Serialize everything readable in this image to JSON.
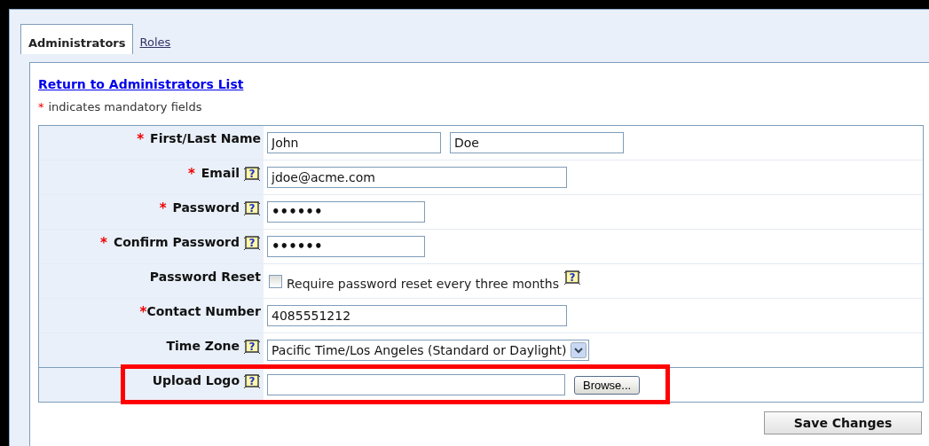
{
  "tabs": [
    {
      "label": "Administrators",
      "selected": true
    },
    {
      "label": "Roles",
      "selected": false
    }
  ],
  "return_link": "Return to Administrators List",
  "legend": {
    "mark": "*",
    "text": "indicates mandatory fields"
  },
  "form": {
    "rows": [
      {
        "kind": "name",
        "label": "First/Last Name",
        "required": true,
        "help": false,
        "values": [
          "John",
          "Doe"
        ]
      },
      {
        "kind": "text",
        "label": "Email",
        "required": true,
        "help": true,
        "value": "jdoe@acme.com"
      },
      {
        "kind": "password",
        "label": "Password",
        "required": true,
        "help": true,
        "value": "••••••"
      },
      {
        "kind": "password",
        "label": "Confirm Password",
        "required": true,
        "help": true,
        "value": "••••••"
      },
      {
        "kind": "checkbox",
        "label": "Password Reset",
        "required": false,
        "help": false,
        "checked": false,
        "text": "Require password reset every three months",
        "text_help": true
      },
      {
        "kind": "text",
        "label": "Contact Number",
        "required": true,
        "tight": true,
        "help": false,
        "value": "4085551212"
      },
      {
        "kind": "select",
        "label": "Time Zone",
        "required": false,
        "help": true,
        "value": "Pacific Time/Los Angeles (Standard or Daylight)"
      },
      {
        "kind": "file",
        "label": "Upload Logo",
        "required": false,
        "help": true,
        "button": "Browse...",
        "highlighted": true
      }
    ]
  },
  "save_button": "Save Changes",
  "help_glyph": "?"
}
